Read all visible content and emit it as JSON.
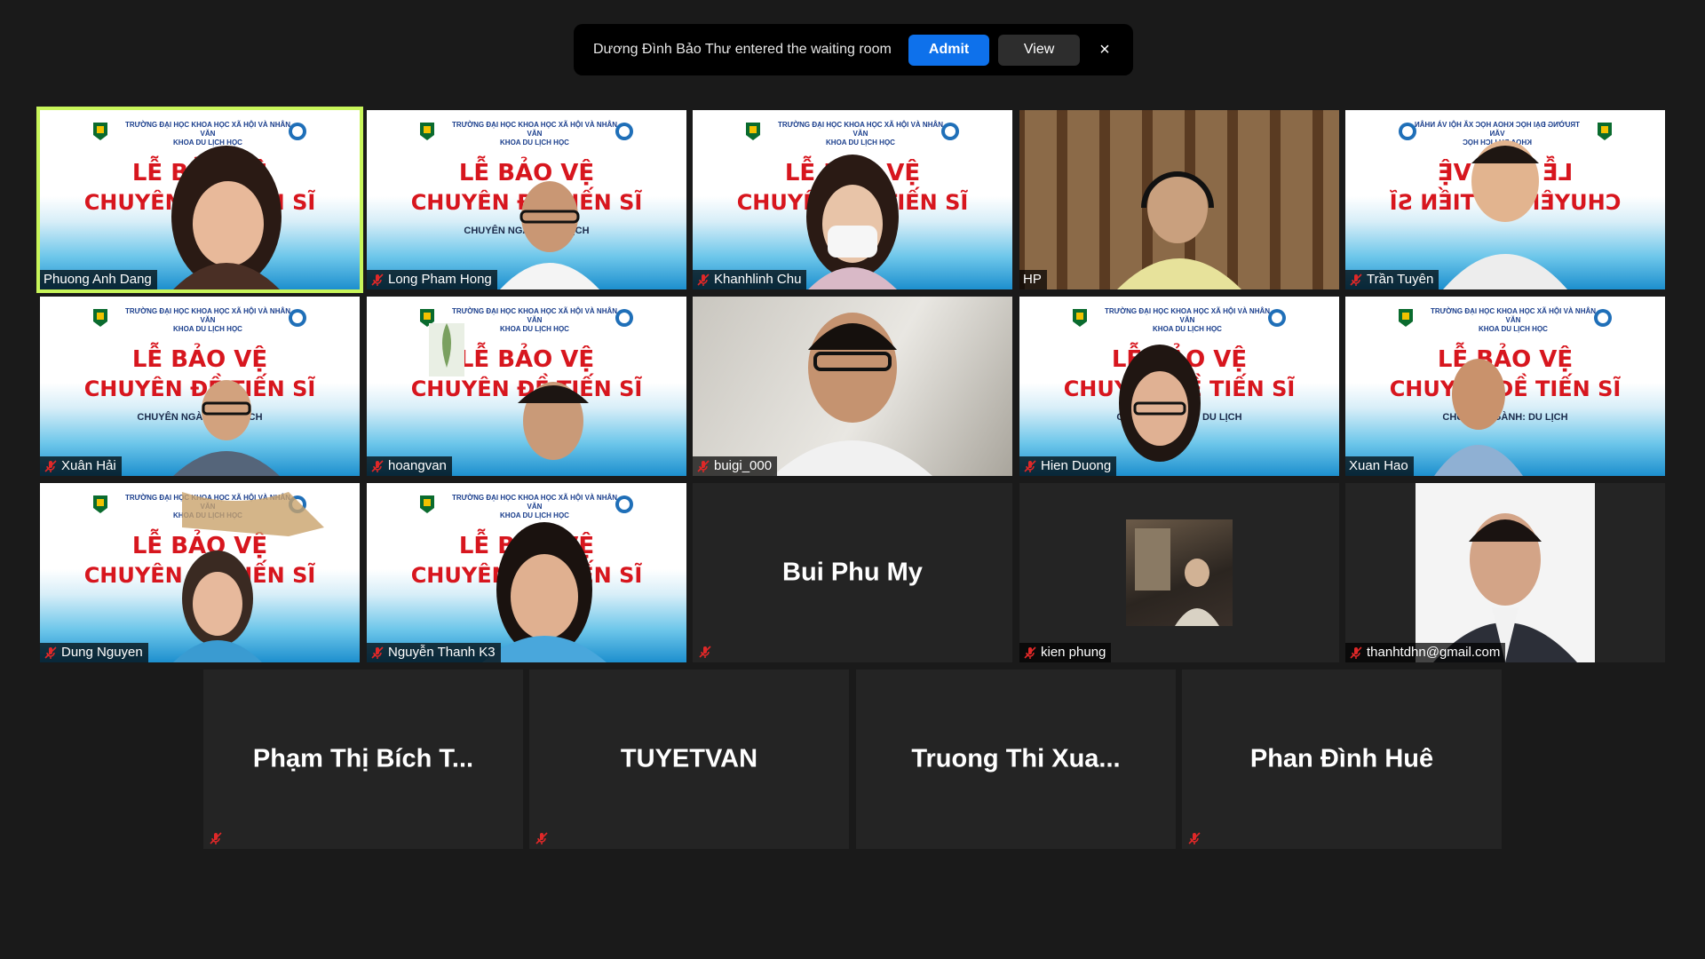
{
  "notification": {
    "text": "Dương Đình Bảo Thư entered the waiting room",
    "admit_label": "Admit",
    "view_label": "View",
    "close_glyph": "×"
  },
  "banner": {
    "school_line1": "TRƯỜNG ĐẠI HỌC KHOA HỌC XÃ HỘI VÀ NHÂN VĂN",
    "school_line2": "KHOA DU LỊCH HỌC",
    "title1": "LỄ BẢO VỆ",
    "title2": "CHUYÊN ĐỀ TIẾN SĨ",
    "title3": "CHUYÊN NGÀNH: DU LỊCH"
  },
  "colors": {
    "active_speaker": "#c8f55a",
    "admit_button": "#0e71eb",
    "muted_icon": "#e02828",
    "tile_bg": "#242424"
  },
  "participants": [
    {
      "name": "Phuong Anh Dang",
      "muted": false,
      "active": true
    },
    {
      "name": "Long Pham Hong",
      "muted": true
    },
    {
      "name": "Khanhlinh Chu",
      "muted": true
    },
    {
      "name": "HP",
      "muted": false
    },
    {
      "name": "Trần Tuyên",
      "muted": true
    },
    {
      "name": "Xuân Hải",
      "muted": true
    },
    {
      "name": "hoangvan",
      "muted": true
    },
    {
      "name": "buigi_000",
      "muted": true
    },
    {
      "name": "Hien Duong",
      "muted": true
    },
    {
      "name": "Xuan Hao",
      "muted": false
    },
    {
      "name": "Dung Nguyen",
      "muted": true
    },
    {
      "name": "Nguyễn Thanh K3",
      "muted": true
    },
    {
      "name": "Bui Phu My",
      "muted": true
    },
    {
      "name": "kien phung",
      "muted": true
    },
    {
      "name": "thanhtdhn@gmail.com",
      "muted": true
    },
    {
      "name": "Phạm Thị Bích T...",
      "muted": true
    },
    {
      "name": "TUYETVAN",
      "muted": true
    },
    {
      "name": "Truong Thi Xua...",
      "muted": true
    },
    {
      "name": "Phan Đình Huê",
      "muted": true
    }
  ]
}
